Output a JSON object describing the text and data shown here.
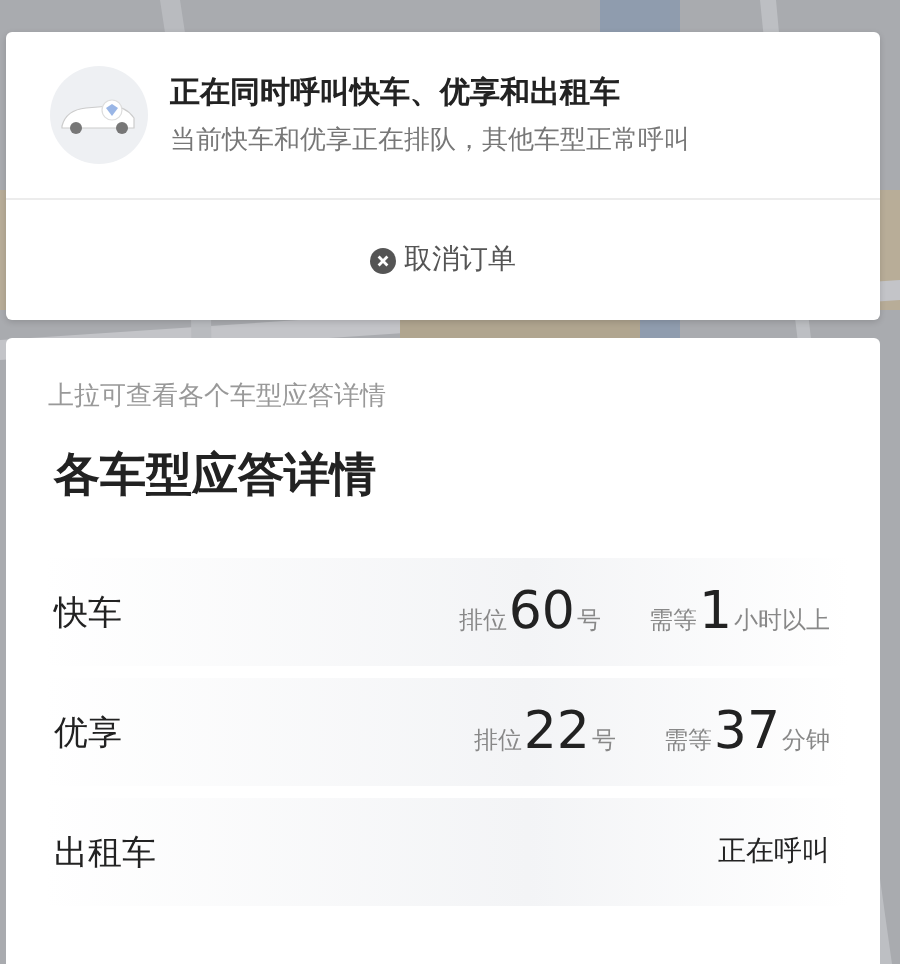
{
  "banner": {
    "title": "正在同时呼叫快车、优享和出租车",
    "subtitle": "当前快车和优享正在排队，其他车型正常呼叫",
    "cancel": "取消订单"
  },
  "details": {
    "hint": "上拉可查看各个车型应答详情",
    "title": "各车型应答详情",
    "rows": [
      {
        "kind": "queue",
        "name": "快车",
        "rank_label": "排位",
        "rank": "60",
        "rank_unit": "号",
        "wait_label": "需等",
        "wait": "1",
        "wait_unit": "小时以上"
      },
      {
        "kind": "queue",
        "name": "优享",
        "rank_label": "排位",
        "rank": "22",
        "rank_unit": "号",
        "wait_label": "需等",
        "wait": "37",
        "wait_unit": "分钟"
      },
      {
        "kind": "status",
        "name": "出租车",
        "status": "正在呼叫"
      }
    ]
  }
}
